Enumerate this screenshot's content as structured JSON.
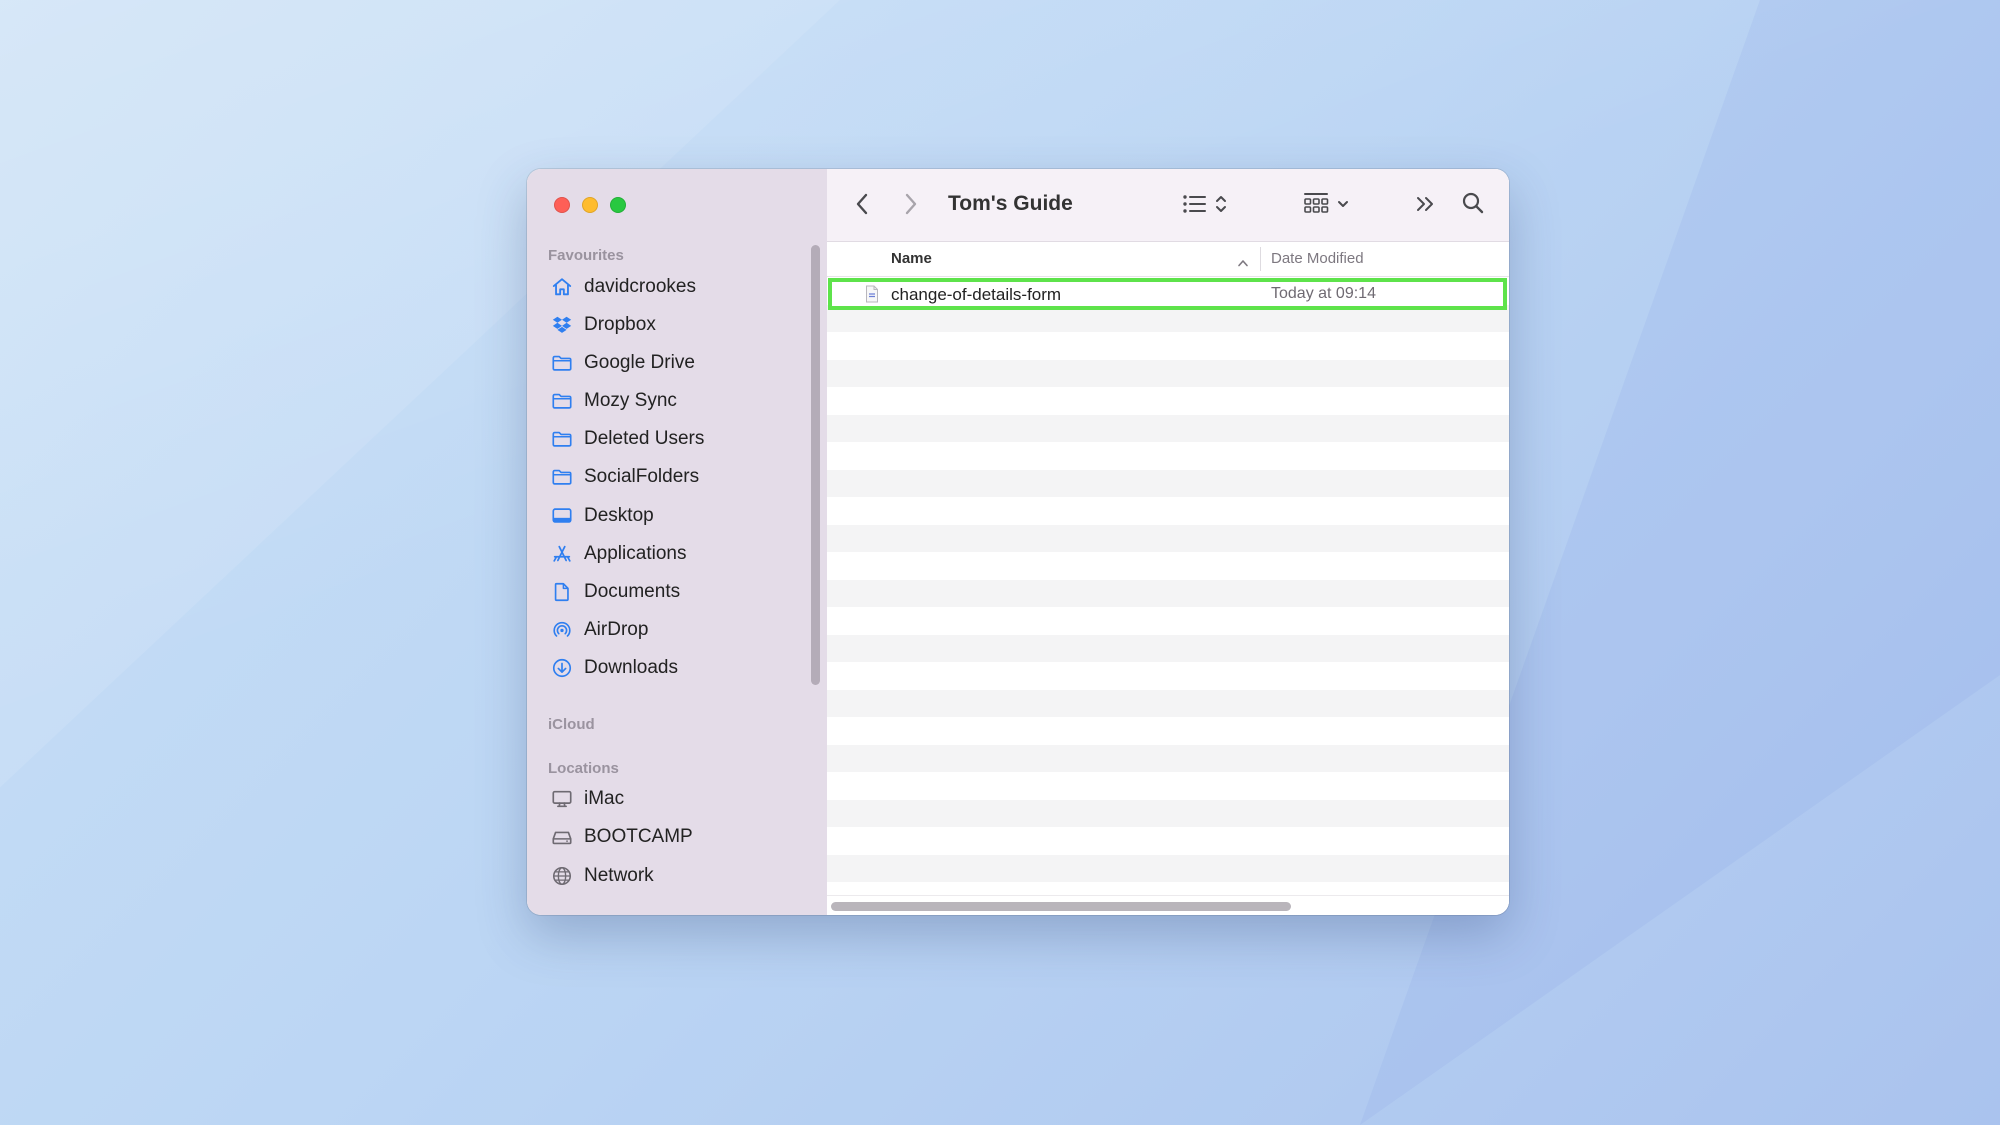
{
  "window": {
    "title": "Tom's Guide"
  },
  "sidebar": {
    "sections": [
      {
        "label": "Favourites",
        "items": [
          {
            "label": "davidcrookes",
            "icon": "home-icon"
          },
          {
            "label": "Dropbox",
            "icon": "dropbox-icon"
          },
          {
            "label": "Google Drive",
            "icon": "folder-icon"
          },
          {
            "label": "Mozy Sync",
            "icon": "folder-icon"
          },
          {
            "label": "Deleted Users",
            "icon": "folder-icon"
          },
          {
            "label": "SocialFolders",
            "icon": "folder-icon"
          },
          {
            "label": "Desktop",
            "icon": "desktop-icon"
          },
          {
            "label": "Applications",
            "icon": "applications-icon"
          },
          {
            "label": "Documents",
            "icon": "document-icon"
          },
          {
            "label": "AirDrop",
            "icon": "airdrop-icon"
          },
          {
            "label": "Downloads",
            "icon": "download-icon"
          }
        ]
      },
      {
        "label": "iCloud",
        "items": []
      },
      {
        "label": "Locations",
        "items": [
          {
            "label": "iMac",
            "icon": "imac-icon"
          },
          {
            "label": "BOOTCAMP",
            "icon": "drive-icon"
          },
          {
            "label": "Network",
            "icon": "network-icon"
          }
        ]
      }
    ]
  },
  "toolbar": {
    "back_icon": "chevron-left-icon",
    "forward_icon": "chevron-right-icon",
    "list_view_icon": "list-view-icon",
    "group_icon": "grid-group-icon",
    "more_icon": "double-chevron-icon",
    "search_icon": "search-icon"
  },
  "list": {
    "columns": {
      "name": "Name",
      "date_modified": "Date Modified"
    },
    "files": [
      {
        "name": "change-of-details-form",
        "date_modified": "Today at 09:14",
        "icon": "document-file-icon"
      }
    ]
  },
  "colors": {
    "accent": "#2f7ff0",
    "highlight": "#5ee34b",
    "sidebar_bg": "#e4dce8"
  }
}
